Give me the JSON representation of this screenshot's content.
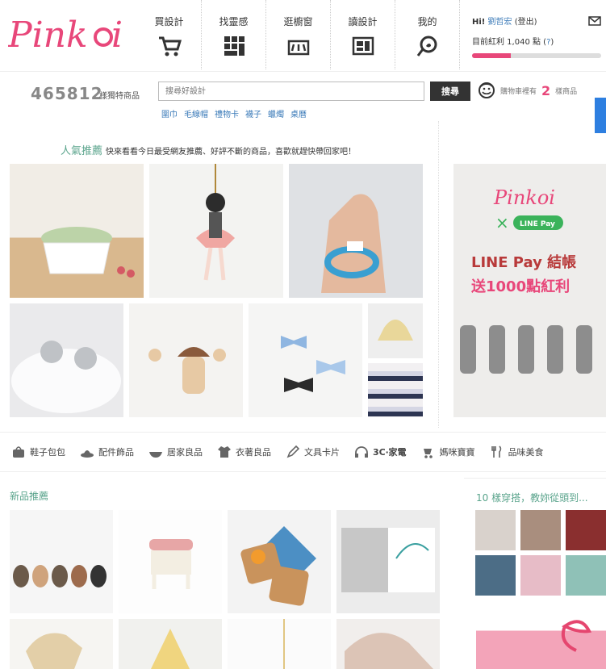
{
  "brand": {
    "logo_text": "Pinkoi",
    "accent": "#e8477a",
    "green": "#5aa48c",
    "link": "#3a7ab8"
  },
  "topnav": [
    {
      "label": "買設計",
      "icon": "cart-icon"
    },
    {
      "label": "找靈感",
      "icon": "grid-icon"
    },
    {
      "label": "逛櫥窗",
      "icon": "storefront-icon"
    },
    {
      "label": "讀設計",
      "icon": "magazine-icon"
    },
    {
      "label": "我的",
      "icon": "profile-pin-icon"
    }
  ],
  "user": {
    "greeting": "Hi!",
    "name": "劉哲宏",
    "logout": "(登出)",
    "points_label": "目前紅利 1,040 點 (",
    "help": "?",
    "points_close": ")",
    "progress": 0.3
  },
  "search": {
    "count": "465812",
    "count_label": "樣獨特商品",
    "placeholder": "搜尋好設計",
    "button": "搜尋",
    "tags": [
      "圍巾",
      "毛線帽",
      "禮物卡",
      "襪子",
      "蠟燭",
      "桌曆"
    ]
  },
  "cart": {
    "label": "購物車裡有",
    "count": "2",
    "suffix": "樣商品"
  },
  "popular": {
    "title": "人氣推薦",
    "desc": "快來看看今日最受網友推薦、好評不斷的商品，喜歡就趕快帶回家吧！"
  },
  "banner": {
    "logo": "Pinkoi",
    "x": "×",
    "linepay": "LINE Pay",
    "line1": "LINE Pay 結帳",
    "line2": "送1000點紅利"
  },
  "categories": [
    {
      "label": "鞋子包包",
      "icon": "bag-icon"
    },
    {
      "label": "配件飾品",
      "icon": "hat-icon"
    },
    {
      "label": "居家良品",
      "icon": "bowl-icon"
    },
    {
      "label": "衣著良品",
      "icon": "shirt-icon"
    },
    {
      "label": "文具卡片",
      "icon": "pen-icon"
    },
    {
      "label": "3C‧家電",
      "icon": "headphones-icon"
    },
    {
      "label": "媽咪寶寶",
      "icon": "stroller-icon"
    },
    {
      "label": "品味美食",
      "icon": "cutlery-icon"
    }
  ],
  "new_items": {
    "title": "新品推薦"
  },
  "side": {
    "title": "10 樣穿搭，教妳從頭到..."
  }
}
